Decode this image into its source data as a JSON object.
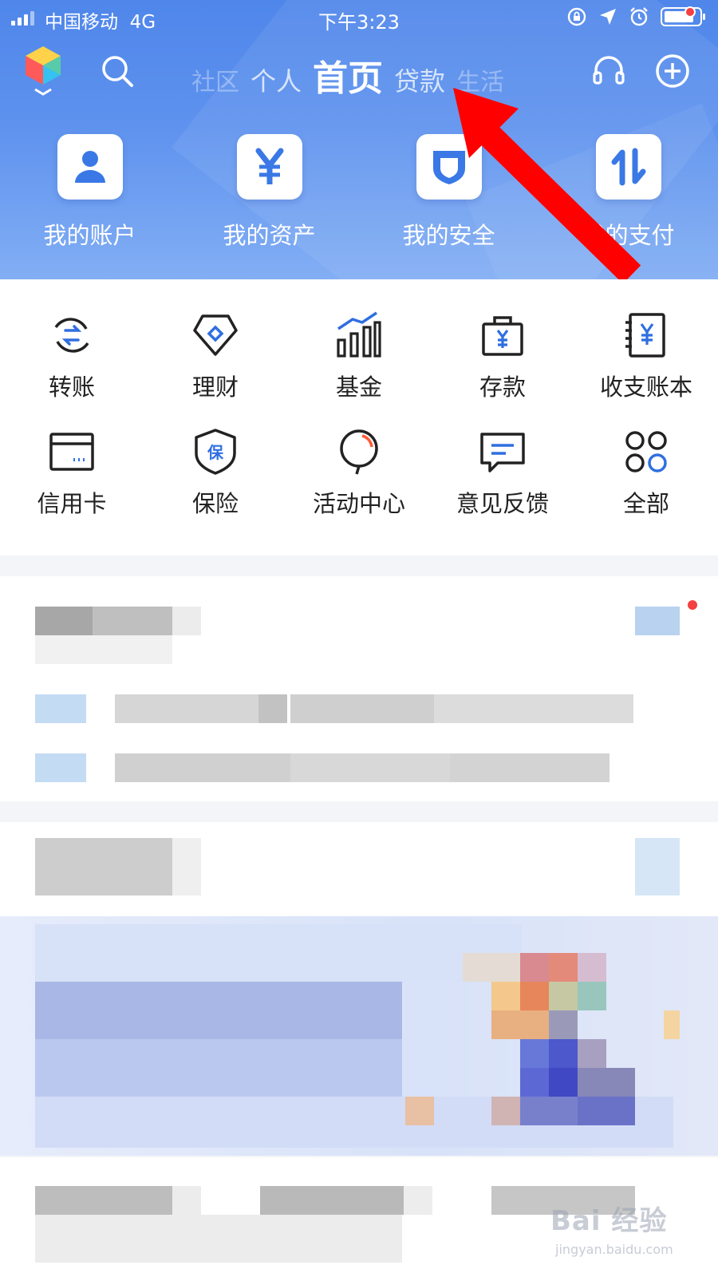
{
  "status_bar": {
    "carrier": "中国移动",
    "network": "4G",
    "time": "下午3:23"
  },
  "nav": {
    "tabs": [
      {
        "label": "社区",
        "state": "faded"
      },
      {
        "label": "个人",
        "state": "normal"
      },
      {
        "label": "首页",
        "state": "active"
      },
      {
        "label": "贷款",
        "state": "normal"
      },
      {
        "label": "生活",
        "state": "faded"
      }
    ],
    "has_notification_dot": true
  },
  "quick_actions": [
    {
      "label": "我的账户",
      "icon": "person-icon"
    },
    {
      "label": "我的资产",
      "icon": "yen-icon"
    },
    {
      "label": "我的安全",
      "icon": "shield-icon"
    },
    {
      "label": "我的支付",
      "icon": "transfer-arrows-icon"
    }
  ],
  "services": [
    {
      "label": "转账",
      "icon": "transfer-icon"
    },
    {
      "label": "理财",
      "icon": "diamond-tag-icon"
    },
    {
      "label": "基金",
      "icon": "bar-chart-icon"
    },
    {
      "label": "存款",
      "icon": "deposit-bag-icon"
    },
    {
      "label": "收支账本",
      "icon": "ledger-icon"
    },
    {
      "label": "信用卡",
      "icon": "credit-card-icon"
    },
    {
      "label": "保险",
      "icon": "insurance-shield-icon"
    },
    {
      "label": "活动中心",
      "icon": "balloon-icon"
    },
    {
      "label": "意见反馈",
      "icon": "feedback-icon"
    },
    {
      "label": "全部",
      "icon": "all-circles-icon"
    }
  ],
  "annotation": {
    "arrow_color": "#ff0000",
    "points_to": "贷款"
  },
  "watermark": {
    "brand": "Bai 经验",
    "url": "jingyan.baidu.com"
  },
  "colors": {
    "header_blue": "#5a8ded",
    "icon_blue": "#2f6fe0",
    "text_dark": "#222222",
    "notification_red": "#f44040"
  }
}
